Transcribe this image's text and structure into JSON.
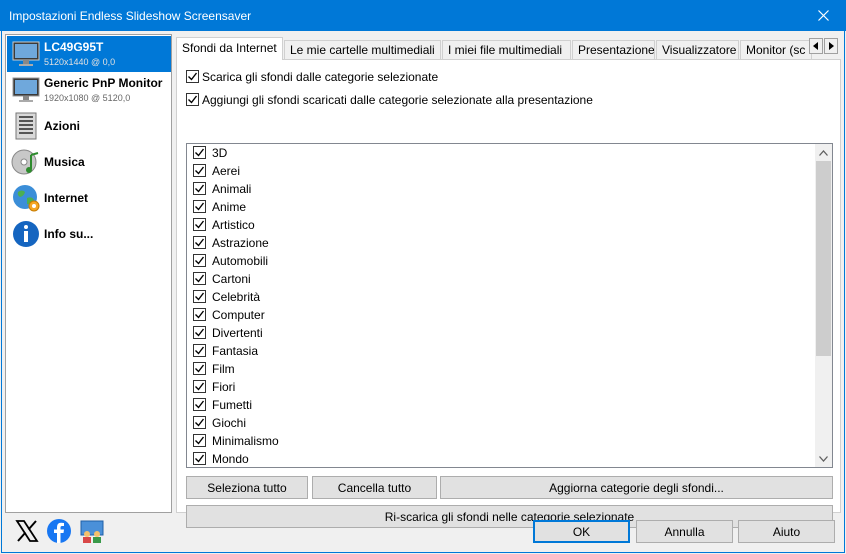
{
  "window": {
    "title": "Impostazioni Endless Slideshow Screensaver"
  },
  "sidebar": {
    "items": [
      {
        "name": "LC49G95T",
        "sub": "5120x1440 @ 0,0",
        "icon": "monitor-icon",
        "selected": true
      },
      {
        "name": "Generic PnP Monitor",
        "sub": "1920x1080 @ 5120,0",
        "icon": "monitor-icon",
        "selected": false
      },
      {
        "name": "Azioni",
        "sub": "",
        "icon": "actions-icon",
        "selected": false
      },
      {
        "name": "Musica",
        "sub": "",
        "icon": "music-icon",
        "selected": false
      },
      {
        "name": "Internet",
        "sub": "",
        "icon": "internet-icon",
        "selected": false
      },
      {
        "name": "Info su...",
        "sub": "",
        "icon": "info-icon",
        "selected": false
      }
    ]
  },
  "tabs": [
    {
      "label": "Sfondi da Internet",
      "active": true
    },
    {
      "label": "Le mie cartelle multimediali",
      "active": false
    },
    {
      "label": "I miei file multimediali",
      "active": false
    },
    {
      "label": "Presentazione",
      "active": false
    },
    {
      "label": "Visualizzatore",
      "active": false
    },
    {
      "label": "Monitor (sc",
      "active": false
    }
  ],
  "options": {
    "download": {
      "label": "Scarica gli sfondi dalle categorie selezionate",
      "checked": true
    },
    "add": {
      "label": "Aggiungi gli sfondi scaricati dalle categorie selezionate alla presentazione",
      "checked": true
    }
  },
  "categories": [
    "3D",
    "Aerei",
    "Animali",
    "Anime",
    "Artistico",
    "Astrazione",
    "Automobili",
    "Cartoni",
    "Celebrità",
    "Computer",
    "Divertenti",
    "Fantasia",
    "Film",
    "Fiori",
    "Fumetti",
    "Giochi",
    "Minimalismo",
    "Mondo"
  ],
  "buttons": {
    "select_all": "Seleziona tutto",
    "clear_all": "Cancella tutto",
    "update_categories": "Aggiorna categorie degli sfondi...",
    "redownload": "Ri-scarica gli sfondi nelle categorie selezionate",
    "ok": "OK",
    "cancel": "Annulla",
    "help": "Aiuto"
  },
  "colors": {
    "accent": "#0078d7",
    "facebook": "#1877f2"
  }
}
